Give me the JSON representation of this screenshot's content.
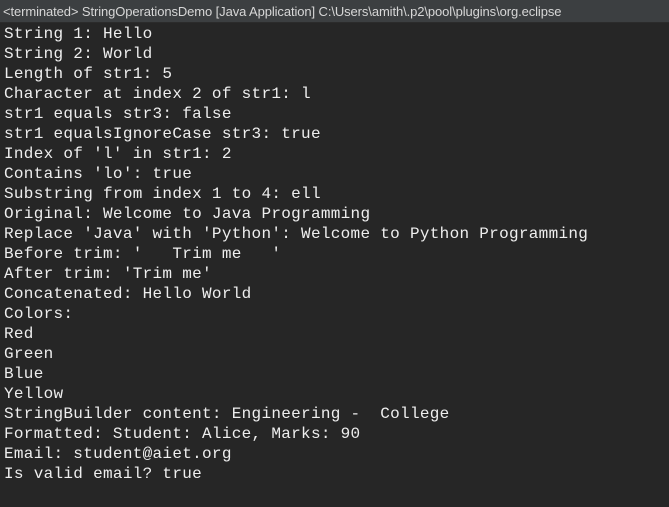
{
  "console": {
    "title": "<terminated> StringOperationsDemo [Java Application] C:\\Users\\amith\\.p2\\pool\\plugins\\org.eclipse",
    "lines": [
      "String 1: Hello",
      "String 2: World",
      "Length of str1: 5",
      "Character at index 2 of str1: l",
      "str1 equals str3: false",
      "str1 equalsIgnoreCase str3: true",
      "Index of 'l' in str1: 2",
      "Contains 'lo': true",
      "Substring from index 1 to 4: ell",
      "Original: Welcome to Java Programming",
      "Replace 'Java' with 'Python': Welcome to Python Programming",
      "Before trim: '   Trim me   '",
      "After trim: 'Trim me'",
      "Concatenated: Hello World",
      "Colors:",
      "Red",
      "Green",
      "Blue",
      "Yellow",
      "StringBuilder content: Engineering -  College",
      "Formatted: Student: Alice, Marks: 90",
      "Email: student@aiet.org",
      "Is valid email? true"
    ]
  }
}
